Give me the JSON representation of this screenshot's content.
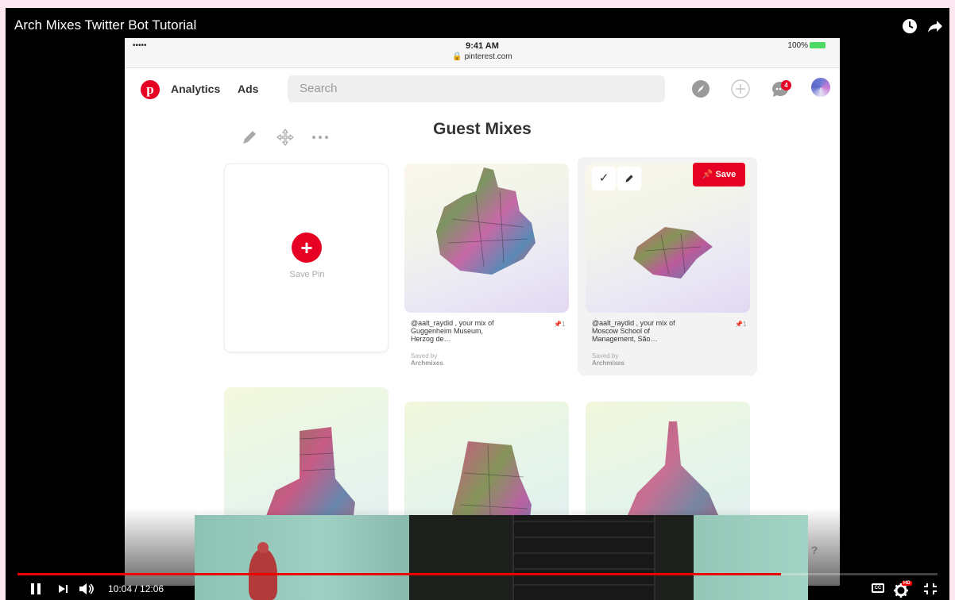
{
  "video": {
    "title": "Arch Mixes Twitter Bot Tutorial",
    "time_current": "10:04",
    "time_total": "12:06",
    "time_display": "10:04 / 12:06",
    "progress_fraction": 0.83,
    "hd_label": "HD",
    "cc_label": "CC"
  },
  "ipad": {
    "signal": "••••• ",
    "time": "9:41 AM",
    "url": "pinterest.com",
    "battery": "100%"
  },
  "pinterest": {
    "logo": "p",
    "nav_links": [
      "Analytics",
      "Ads"
    ],
    "search_placeholder": "Search",
    "notification_count": "4",
    "board_title": "Guest Mixes",
    "save_pin_label": "Save Pin",
    "save_button_label": "Save",
    "help_label": "?",
    "pins": [
      {
        "caption": "@aalt_raydid , your mix of Guggenheim Museum, Herzog de…",
        "caption_lines": [
          "@aalt_raydid , your mix of",
          "Guggenheim Museum,",
          "Herzog de…"
        ],
        "pin_count": "1",
        "saved_by_label": "Saved by",
        "saved_by": "Archmixes"
      },
      {
        "caption": "@aalt_raydid , your mix of Moscow School of Management, São…",
        "caption_lines": [
          "@aalt_raydid , your mix of",
          "Moscow School of",
          "Management, São…"
        ],
        "pin_count": "1",
        "saved_by_label": "Saved by",
        "saved_by": "Archmixes"
      }
    ]
  },
  "colors": {
    "pinterest_red": "#e60023",
    "progress_red": "#ee0000"
  }
}
